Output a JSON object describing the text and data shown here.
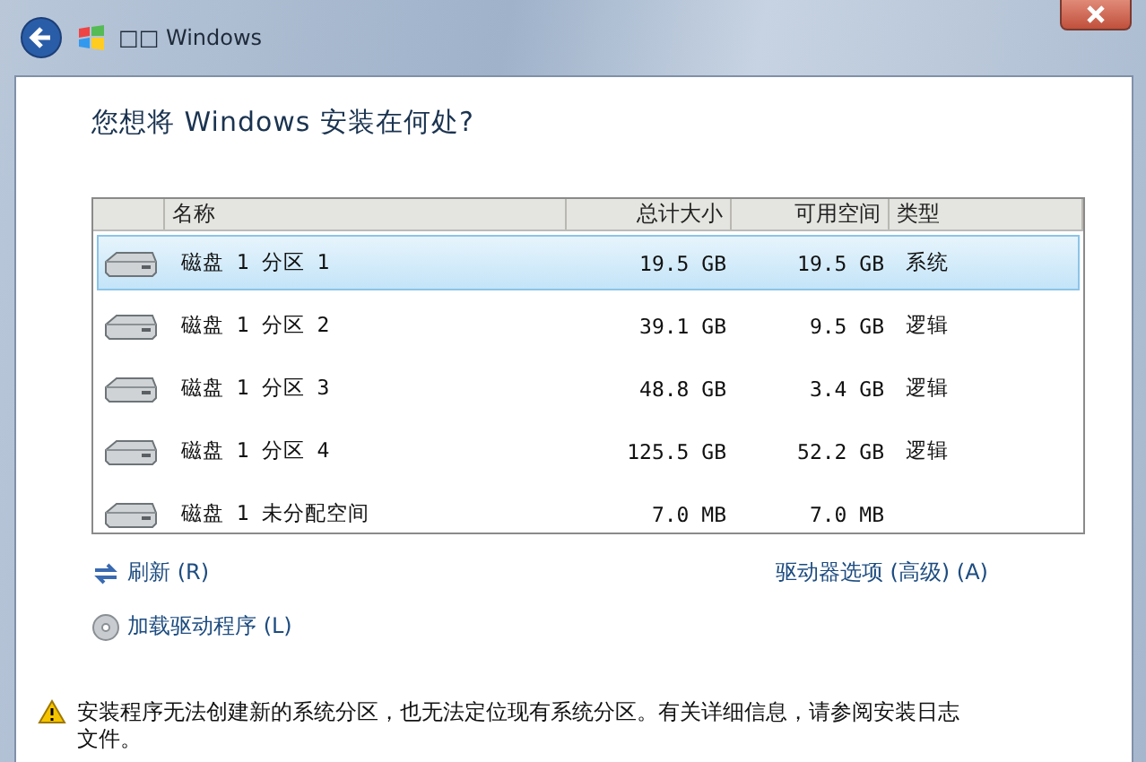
{
  "window": {
    "title": "□□ Windows"
  },
  "heading": "您想将 Windows 安装在何处?",
  "table": {
    "columns": [
      "名称",
      "总计大小",
      "可用空间",
      "类型"
    ],
    "rows": [
      {
        "name": "磁盘 1 分区 1",
        "total": "19.5 GB",
        "free": "19.5 GB",
        "type": "系统",
        "selected": true
      },
      {
        "name": "磁盘 1 分区 2",
        "total": "39.1 GB",
        "free": "9.5 GB",
        "type": "逻辑",
        "selected": false
      },
      {
        "name": "磁盘 1 分区 3",
        "total": "48.8 GB",
        "free": "3.4 GB",
        "type": "逻辑",
        "selected": false
      },
      {
        "name": "磁盘 1 分区 4",
        "total": "125.5 GB",
        "free": "52.2 GB",
        "type": "逻辑",
        "selected": false
      },
      {
        "name": "磁盘 1 未分配空间",
        "total": "7.0 MB",
        "free": "7.0 MB",
        "selected": false
      }
    ]
  },
  "links": [
    {
      "kind": "refresh",
      "label": "刷新 (R)"
    },
    {
      "kind": "advanced",
      "label": "驱动器选项 (高级) (A)"
    },
    {
      "kind": "driver",
      "label": "加载驱动程序 (L)"
    }
  ],
  "warning": "安装程序无法创建新的系统分区，也无法定位现有系统分区。有关详细信息，请参阅安装日志文件。"
}
